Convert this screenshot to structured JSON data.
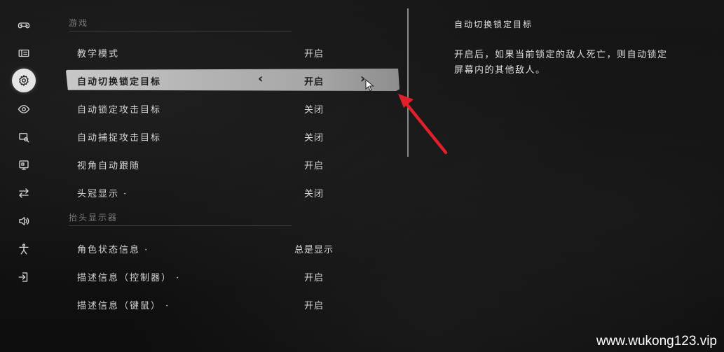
{
  "sidebar": {
    "items": [
      {
        "name": "gamepad-icon"
      },
      {
        "name": "display-icon"
      },
      {
        "name": "gear-icon",
        "active": true
      },
      {
        "name": "eye-icon"
      },
      {
        "name": "search-screen-icon"
      },
      {
        "name": "monitor-icon"
      },
      {
        "name": "swap-arrows-icon"
      },
      {
        "name": "speaker-icon"
      },
      {
        "name": "accessibility-icon"
      },
      {
        "name": "exit-icon"
      }
    ]
  },
  "sections": [
    {
      "title": "游戏",
      "rows": [
        {
          "label": "教学模式",
          "value": "开启"
        },
        {
          "label": "自动切换锁定目标",
          "value": "开启",
          "selected": true
        },
        {
          "label": "自动锁定攻击目标",
          "value": "关闭"
        },
        {
          "label": "自动捕捉攻击目标",
          "value": "关闭"
        },
        {
          "label": "视角自动跟随",
          "value": "开启"
        },
        {
          "label": "头冠显示 ·",
          "value": "关闭"
        }
      ]
    },
    {
      "title": "抬头显示器",
      "rows": [
        {
          "label": "角色状态信息 ·",
          "value": "总是显示"
        },
        {
          "label": "描述信息（控制器） ·",
          "value": "开启"
        },
        {
          "label": "描述信息（键鼠） ·",
          "value": "开启"
        }
      ]
    }
  ],
  "selector": {
    "left_arrow": "‹",
    "right_arrow": "›"
  },
  "description": {
    "title": "自动切换锁定目标",
    "text": "开启后，如果当前锁定的敌人死亡，则自动锁定屏幕内的其他敌人。"
  },
  "watermark": "www.wukong123.vip",
  "colors": {
    "selected_bar": "#c0c0c0",
    "annotation_arrow": "#e0202a"
  }
}
